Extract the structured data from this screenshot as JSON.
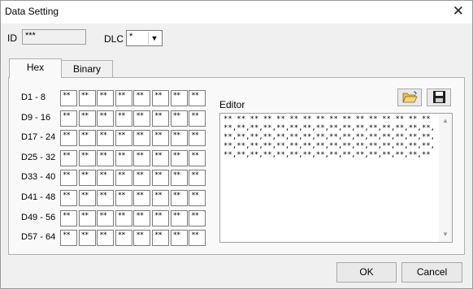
{
  "window": {
    "title": "Data Setting",
    "close_glyph": "✕"
  },
  "id_field": {
    "label": "ID",
    "value": "***"
  },
  "dlc": {
    "label": "DLC",
    "value": "*"
  },
  "tabs": [
    {
      "label": "Hex",
      "active": true
    },
    {
      "label": "Binary",
      "active": false
    }
  ],
  "rows": [
    {
      "label": "D1 - 8",
      "cells": [
        "**",
        "**",
        "**",
        "**",
        "**",
        "**",
        "**",
        "**"
      ]
    },
    {
      "label": "D9 - 16",
      "cells": [
        "**",
        "**",
        "**",
        "**",
        "**",
        "**",
        "**",
        "**"
      ]
    },
    {
      "label": "D17 - 24",
      "cells": [
        "**",
        "**",
        "**",
        "**",
        "**",
        "**",
        "**",
        "**"
      ]
    },
    {
      "label": "D25 - 32",
      "cells": [
        "**",
        "**",
        "**",
        "**",
        "**",
        "**",
        "**",
        "**"
      ]
    },
    {
      "label": "D33 - 40",
      "cells": [
        "**",
        "**",
        "**",
        "**",
        "**",
        "**",
        "**",
        "**"
      ]
    },
    {
      "label": "D41 - 48",
      "cells": [
        "**",
        "**",
        "**",
        "**",
        "**",
        "**",
        "**",
        "**"
      ]
    },
    {
      "label": "D49 - 56",
      "cells": [
        "**",
        "**",
        "**",
        "**",
        "**",
        "**",
        "**",
        "**"
      ]
    },
    {
      "label": "D57 - 64",
      "cells": [
        "**",
        "**",
        "**",
        "**",
        "**",
        "**",
        "**",
        "**"
      ]
    }
  ],
  "editor": {
    "label": "Editor",
    "content": "** ** ** ** ** ** ** ** ** ** ** ** ** ** ** ** **,**,**,**,**,**,**,**,**,**,**,**,**,**,**,**,**,**,**,**,**,**,**,**,**,**,**,**,**,**,**,**,**,**,**,**,**,**,**,**,**,**,**,**,**,**,**,**,**,**,**,**,**,**,**,**,**,**,**,**,**,**,**,**"
  },
  "buttons": {
    "ok": "OK",
    "cancel": "Cancel"
  },
  "icons": {
    "open": "folder-open-icon",
    "save": "floppy-save-icon"
  }
}
